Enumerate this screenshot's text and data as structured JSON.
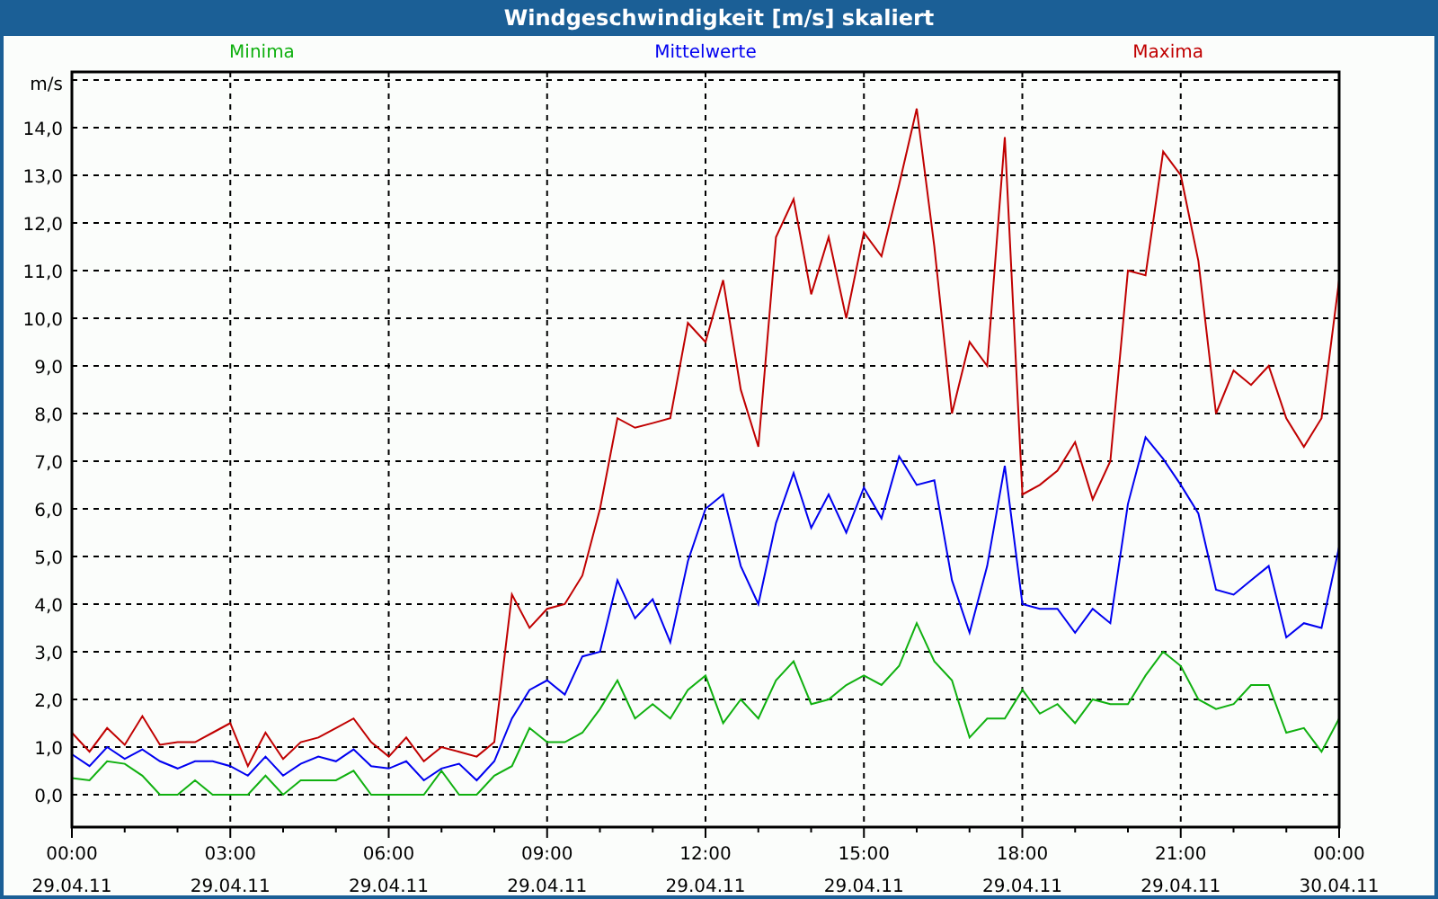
{
  "window": {
    "title": "Windgeschwindigkeit [m/s] skaliert"
  },
  "chart_data": {
    "type": "line",
    "ylabel": "m/s",
    "categories": [
      "00:00 29.04.11",
      null,
      null,
      null,
      null,
      null,
      null,
      null,
      null,
      "03:00 29.04.11",
      null,
      null,
      null,
      null,
      null,
      null,
      null,
      null,
      "06:00 29.04.11",
      null,
      null,
      null,
      null,
      null,
      null,
      null,
      null,
      "09:00 29.04.11",
      null,
      null,
      null,
      null,
      null,
      null,
      null,
      null,
      "12:00 29.04.11",
      null,
      null,
      null,
      null,
      null,
      null,
      null,
      null,
      "15:00 29.04.11",
      null,
      null,
      null,
      null,
      null,
      null,
      null,
      null,
      "18:00 29.04.11",
      null,
      null,
      null,
      null,
      null,
      null,
      null,
      null,
      "21:00 29.04.11",
      null,
      null,
      null,
      null,
      null,
      null,
      null,
      null,
      "00:00 30.04.11"
    ],
    "series": [
      {
        "name": "Minima",
        "color": "#10b010",
        "values": [
          0.35,
          0.3,
          0.7,
          0.65,
          0.4,
          0,
          0,
          0.3,
          0,
          0,
          0,
          0.4,
          0,
          0.3,
          0.3,
          0.3,
          0.5,
          0,
          0,
          0,
          0,
          0.5,
          0,
          0,
          0.4,
          0.6,
          1.4,
          1.1,
          1.1,
          1.3,
          1.8,
          2.4,
          1.6,
          1.9,
          1.6,
          2.2,
          2.5,
          1.5,
          2.0,
          1.6,
          2.4,
          2.8,
          1.9,
          2.0,
          2.3,
          2.5,
          2.3,
          2.7,
          3.6,
          2.8,
          2.4,
          1.2,
          1.6,
          1.6,
          2.2,
          1.7,
          1.9,
          1.5,
          2.0,
          1.9,
          1.9,
          2.5,
          3.0,
          2.7,
          2.0,
          1.8,
          1.9,
          2.3,
          2.3,
          1.3,
          1.4,
          0.9,
          1.6
        ]
      },
      {
        "name": "Mittelwerte",
        "color": "#0000f0",
        "values": [
          0.85,
          0.6,
          1.0,
          0.75,
          0.95,
          0.7,
          0.55,
          0.7,
          0.7,
          0.6,
          0.4,
          0.8,
          0.4,
          0.65,
          0.8,
          0.7,
          0.95,
          0.6,
          0.55,
          0.7,
          0.3,
          0.55,
          0.65,
          0.3,
          0.7,
          1.6,
          2.2,
          2.4,
          2.1,
          2.9,
          3.0,
          4.5,
          3.7,
          4.1,
          3.2,
          4.9,
          6.0,
          6.3,
          4.8,
          4.0,
          5.7,
          6.75,
          5.6,
          6.3,
          5.5,
          6.45,
          5.8,
          7.1,
          6.5,
          6.6,
          4.5,
          3.4,
          4.8,
          6.9,
          4.0,
          3.9,
          3.9,
          3.4,
          3.9,
          3.6,
          6.1,
          7.5,
          7.05,
          6.5,
          5.9,
          4.3,
          4.2,
          4.5,
          4.8,
          3.3,
          3.6,
          3.5,
          5.2
        ]
      },
      {
        "name": "Maxima",
        "color": "#c00000",
        "values": [
          1.3,
          0.9,
          1.4,
          1.05,
          1.65,
          1.05,
          1.1,
          1.1,
          1.3,
          1.5,
          0.6,
          1.3,
          0.75,
          1.1,
          1.2,
          1.4,
          1.6,
          1.1,
          0.8,
          1.2,
          0.7,
          1.0,
          0.9,
          0.8,
          1.1,
          4.2,
          3.5,
          3.9,
          4.0,
          4.6,
          6.0,
          7.9,
          7.7,
          7.8,
          7.9,
          9.9,
          9.5,
          10.8,
          8.5,
          7.3,
          11.7,
          12.5,
          10.5,
          11.7,
          10.0,
          11.8,
          11.3,
          12.8,
          14.4,
          11.5,
          8.0,
          9.5,
          9.0,
          13.8,
          6.3,
          6.5,
          6.8,
          7.4,
          6.2,
          7.0,
          11.0,
          10.9,
          13.5,
          13.0,
          11.2,
          8.0,
          8.9,
          8.6,
          9.0,
          7.9,
          7.3,
          7.9,
          10.8
        ]
      }
    ],
    "ylim": [
      -0.68,
      15.17
    ],
    "grid": true,
    "yticks": [
      {
        "value": 0,
        "label": "0,0"
      },
      {
        "value": 1,
        "label": "1,0"
      },
      {
        "value": 2,
        "label": "2,0"
      },
      {
        "value": 3,
        "label": "3,0"
      },
      {
        "value": 4,
        "label": "4,0"
      },
      {
        "value": 5,
        "label": "5,0"
      },
      {
        "value": 6,
        "label": "6,0"
      },
      {
        "value": 7,
        "label": "7,0"
      },
      {
        "value": 8,
        "label": "8,0"
      },
      {
        "value": 9,
        "label": "9,0"
      },
      {
        "value": 10,
        "label": "10,0"
      },
      {
        "value": 11,
        "label": "11,0"
      },
      {
        "value": 12,
        "label": "12,0"
      },
      {
        "value": 13,
        "label": "13,0"
      },
      {
        "value": 14,
        "label": "14,0"
      }
    ]
  }
}
